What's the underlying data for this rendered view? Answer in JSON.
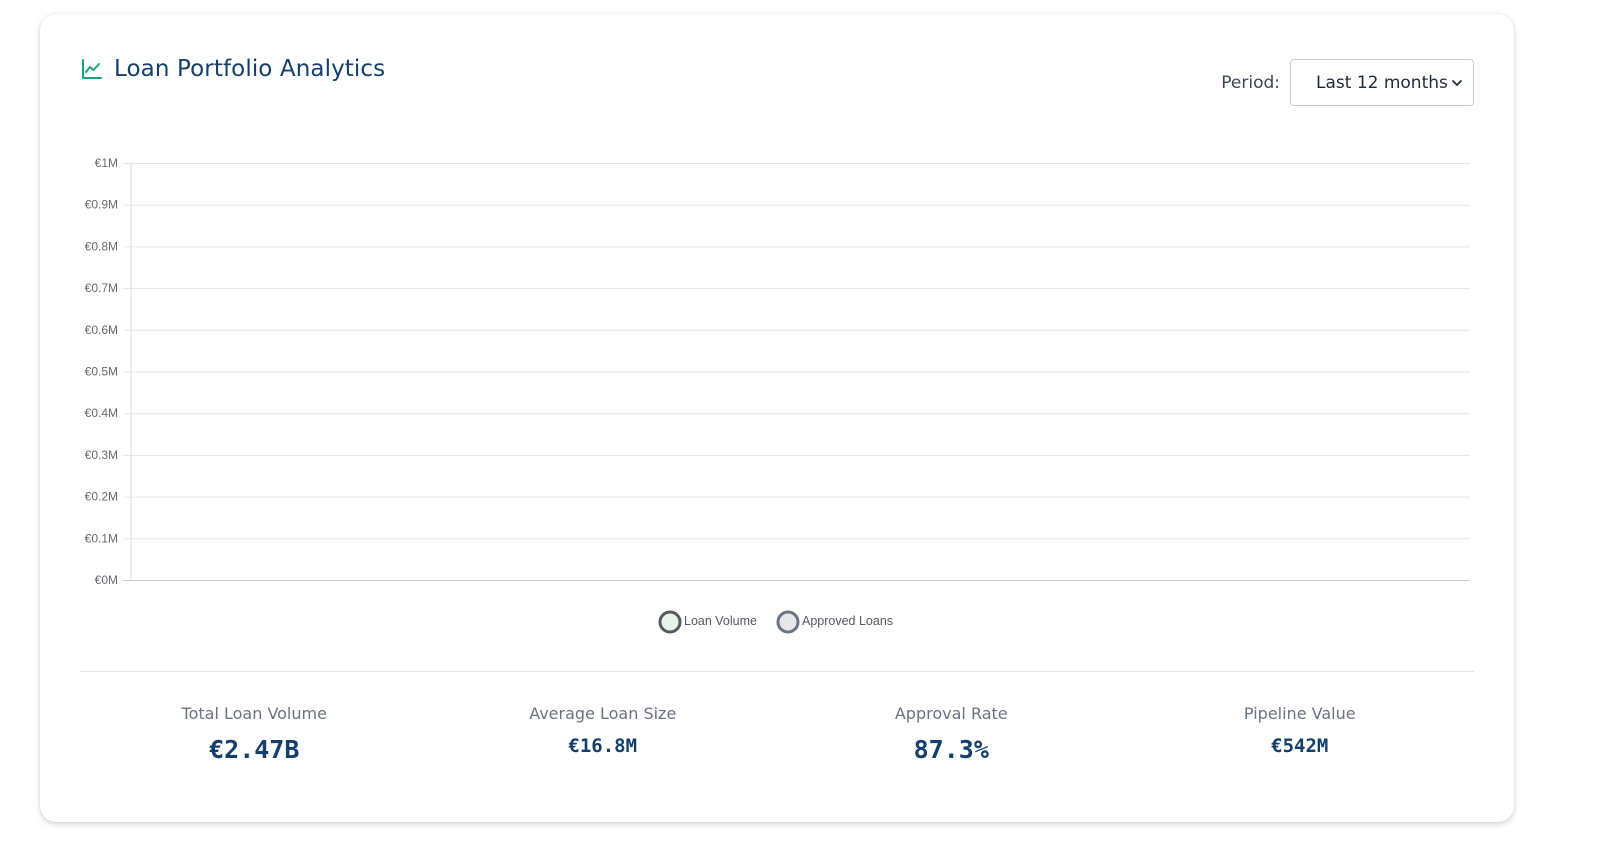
{
  "header": {
    "title": "Loan Portfolio Analytics",
    "title_icon": "line-chart-icon",
    "period_label": "Period:",
    "period_selected": "Last 12 months"
  },
  "colors": {
    "title": "#123f6b",
    "title_icon": "#1aa672",
    "value": "#123f6b",
    "grid": "#e5e5e5"
  },
  "chart_data": {
    "type": "line",
    "currency": "€",
    "y_ticks": [
      "€0M",
      "€0.1M",
      "€0.2M",
      "€0.3M",
      "€0.4M",
      "€0.5M",
      "€0.6M",
      "€0.7M",
      "€0.8M",
      "€0.9M",
      "€1M"
    ],
    "ylim": [
      0,
      1
    ],
    "grid": true,
    "legend_position": "bottom",
    "series": [
      {
        "name": "Loan Volume",
        "values": [],
        "color": "#3c7a5a",
        "fill": "#e6f3ea"
      },
      {
        "name": "Approved Loans",
        "values": [],
        "color": "#6b7280",
        "fill": "#e5e7eb"
      }
    ]
  },
  "metrics": [
    {
      "label": "Total Loan Volume",
      "value": "€2.47B",
      "size": "big"
    },
    {
      "label": "Average Loan Size",
      "value": "€16.8M",
      "size": "small"
    },
    {
      "label": "Approval Rate",
      "value": "87.3%",
      "size": "big"
    },
    {
      "label": "Pipeline Value",
      "value": "€542M",
      "size": "small"
    }
  ]
}
